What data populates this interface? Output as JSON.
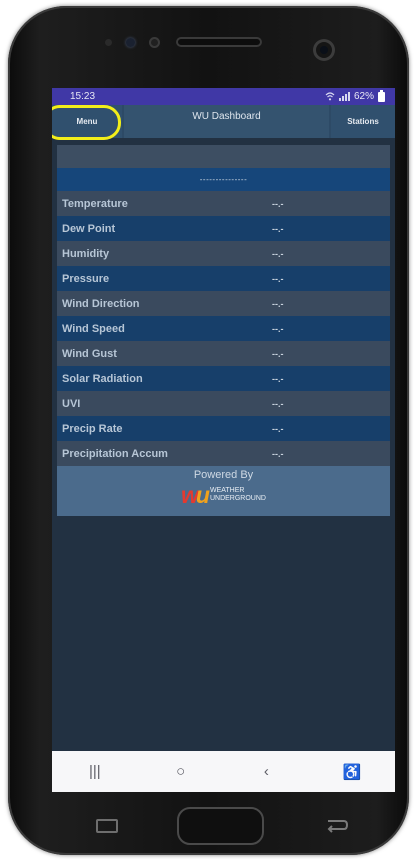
{
  "status_bar": {
    "time": "15:23",
    "battery": "62%",
    "wifi_icon": "wifi-icon",
    "signal_icon": "signal-icon"
  },
  "app_bar": {
    "menu_label": "Menu",
    "title": "WU Dashboard",
    "stations_label": "Stations"
  },
  "station": {
    "name_placeholder": "---------------"
  },
  "readings": [
    {
      "label": "Temperature",
      "value": "--.-"
    },
    {
      "label": "Dew Point",
      "value": "--.-"
    },
    {
      "label": "Humidity",
      "value": "--.-"
    },
    {
      "label": "Pressure",
      "value": "--.-"
    },
    {
      "label": "Wind Direction",
      "value": "--.-"
    },
    {
      "label": "Wind Speed",
      "value": "--.-"
    },
    {
      "label": "Wind Gust",
      "value": "--.-"
    },
    {
      "label": "Solar Radiation",
      "value": "--.-"
    },
    {
      "label": "UVI",
      "value": "--.-"
    },
    {
      "label": "Precip Rate",
      "value": "--.-"
    },
    {
      "label": "Precipitation Accum",
      "value": "--.-"
    }
  ],
  "footer": {
    "powered_by": "Powered By",
    "logo_mark_w": "w",
    "logo_mark_u": "u",
    "logo_line1": "WEATHER",
    "logo_line2": "UNDERGROUND"
  },
  "nav": {
    "recents": "|||",
    "home": "○",
    "back": "‹",
    "accessibility": "♿"
  },
  "colors": {
    "status_bar": "#4038a6",
    "app_bar": "#2d4a66",
    "highlight": "#f2ee1a",
    "logo_red": "#e33a30",
    "logo_orange": "#f1a21c"
  }
}
